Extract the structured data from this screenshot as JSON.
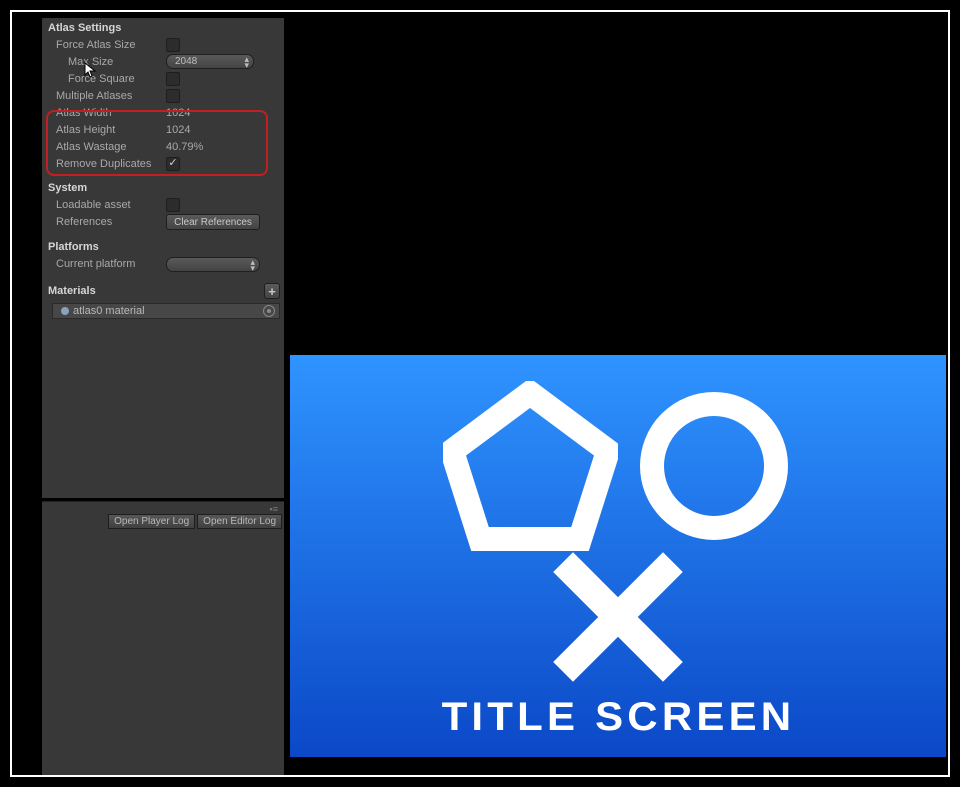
{
  "atlas_settings": {
    "header": "Atlas Settings",
    "force_atlas_label": "Force Atlas Size",
    "force_atlas_checked": false,
    "max_size_label": "Max Size",
    "max_size_value": "2048",
    "force_square_label": "Force Square",
    "force_square_checked": false,
    "multiple_atlases_label": "Multiple Atlases",
    "multiple_atlases_checked": false,
    "atlas_width_label": "Atlas Width",
    "atlas_width_value": "1024",
    "atlas_height_label": "Atlas Height",
    "atlas_height_value": "1024",
    "atlas_wastage_label": "Atlas Wastage",
    "atlas_wastage_value": "40.79%",
    "remove_duplicates_label": "Remove Duplicates",
    "remove_duplicates_checked": true
  },
  "system": {
    "header": "System",
    "loadable_label": "Loadable asset",
    "loadable_checked": false,
    "references_label": "References",
    "clear_refs_btn": "Clear References"
  },
  "platforms": {
    "header": "Platforms",
    "current_platform_label": "Current platform",
    "current_platform_value": ""
  },
  "materials": {
    "header": "Materials",
    "add_btn": "+",
    "item0": "atlas0 material"
  },
  "console": {
    "open_player_log": "Open Player Log",
    "open_editor_log": "Open Editor Log"
  },
  "game": {
    "title": "TITLE SCREEN"
  }
}
